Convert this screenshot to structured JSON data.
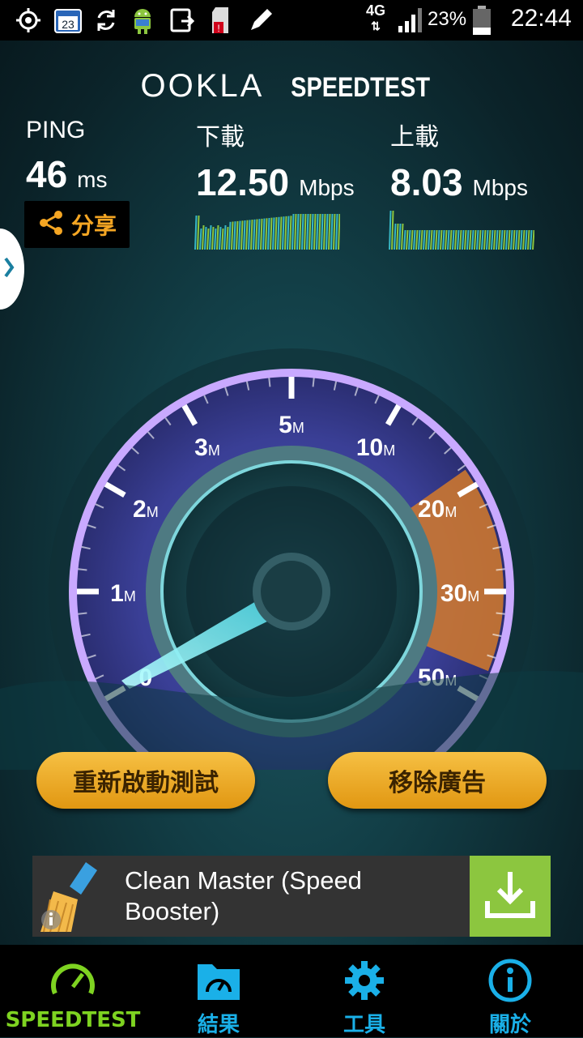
{
  "status_bar": {
    "network": "4G",
    "battery": "23%",
    "time": "22:44",
    "calendar_day": "23",
    "icons": [
      "location-icon",
      "calendar-icon",
      "sync-icon",
      "android-icon",
      "screenshot-icon",
      "sd-card-alert-icon",
      "pencil-icon",
      "signal-icon",
      "battery-icon"
    ]
  },
  "header": {
    "brand": "OOKLA",
    "product": "SPEEDTEST"
  },
  "ping": {
    "label": "PING",
    "value": "46",
    "unit": "ms"
  },
  "download": {
    "label": "下載",
    "value": "12.50",
    "unit": "Mbps"
  },
  "upload": {
    "label": "上載",
    "value": "8.03",
    "unit": "Mbps"
  },
  "share": {
    "label": "分享"
  },
  "gauge": {
    "ticks": [
      {
        "v": "0",
        "u": ""
      },
      {
        "v": "1",
        "u": "M"
      },
      {
        "v": "2",
        "u": "M"
      },
      {
        "v": "3",
        "u": "M"
      },
      {
        "v": "5",
        "u": "M"
      },
      {
        "v": "10",
        "u": "M"
      },
      {
        "v": "20",
        "u": "M"
      },
      {
        "v": "30",
        "u": "M"
      },
      {
        "v": "50",
        "u": "M"
      }
    ]
  },
  "buttons": {
    "restart": "重新啟動測試",
    "remove_ads": "移除廣告"
  },
  "ad": {
    "text": "Clean Master (Speed Booster)"
  },
  "nav": [
    {
      "label": "SPEEDTEST",
      "icon": "speedometer-icon",
      "active": true
    },
    {
      "label": "結果",
      "icon": "results-folder-icon",
      "active": false
    },
    {
      "label": "工具",
      "icon": "gear-icon",
      "active": false
    },
    {
      "label": "關於",
      "icon": "info-icon",
      "active": false
    }
  ],
  "colors": {
    "accent": "#f5a623",
    "nav_active": "#7ed321",
    "nav_icon": "#1ab0e8",
    "bg": "#0d2b31"
  }
}
